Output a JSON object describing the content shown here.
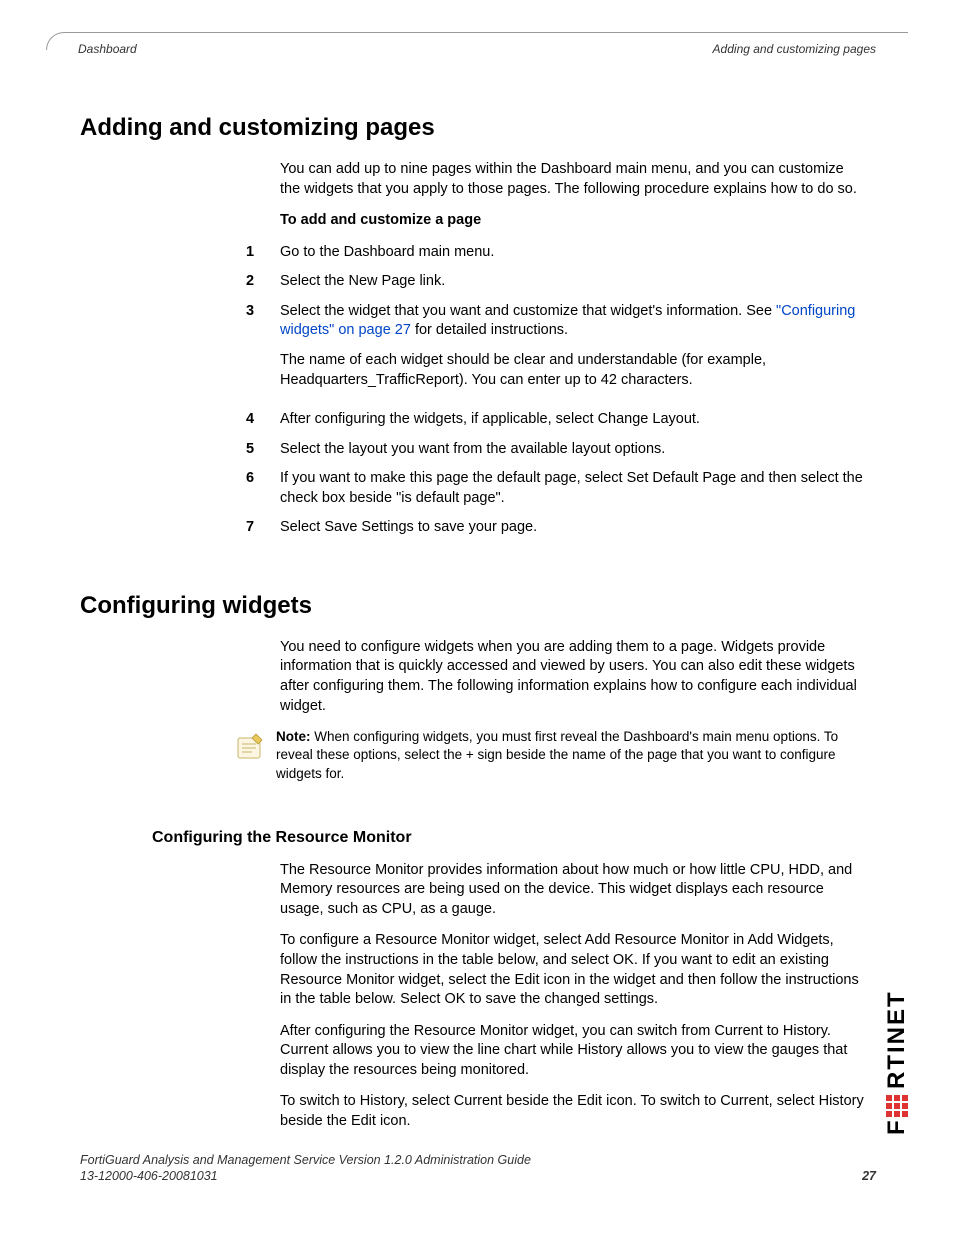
{
  "header": {
    "left": "Dashboard",
    "right": "Adding and customizing pages"
  },
  "section1": {
    "title": "Adding and customizing pages",
    "intro": "You can add up to nine pages within the Dashboard main menu, and you can customize the widgets that you apply to those pages. The following procedure explains how to do so.",
    "procTitle": "To add and customize a page",
    "steps": {
      "s1": "Go to the Dashboard main menu.",
      "s2": "Select the New Page link.",
      "s3a": "Select the widget that you want and customize that widget's information. See ",
      "s3link": "\"Configuring widgets\" on page 27",
      "s3b": " for detailed instructions.",
      "s3p2": "The name of each widget should be clear and understandable (for example, Headquarters_TrafficReport). You can enter up to 42 characters.",
      "s4": "After configuring the widgets, if applicable, select Change Layout.",
      "s5": "Select the layout you want from the available layout options.",
      "s6": "If you want to make this page the default page, select Set Default Page and then select the check box beside \"is default page\".",
      "s7": "Select Save Settings to save your page."
    }
  },
  "section2": {
    "title": "Configuring widgets",
    "intro": "You need to configure widgets when you are adding them to a page. Widgets provide information that is quickly accessed and viewed by users. You can also edit these widgets after configuring them. The following information explains how to configure each individual widget.",
    "noteLabel": "Note:",
    "noteText": " When configuring widgets, you must first reveal the Dashboard's main menu options. To reveal these options, select the + sign beside the name of the page that you want to configure widgets for.",
    "sub": {
      "title": "Configuring the Resource Monitor",
      "p1": "The Resource Monitor provides information about how much or how little CPU, HDD, and Memory resources are being used on the device. This widget displays each resource usage, such as CPU, as a gauge.",
      "p2": "To configure a Resource Monitor widget, select Add Resource Monitor in Add Widgets, follow the instructions in the table below, and select OK. If you want to edit an existing Resource Monitor widget, select the Edit icon in the widget and then follow the instructions in the table below. Select OK to save the changed settings.",
      "p3": "After configuring the Resource Monitor widget, you can switch from Current to History. Current allows you to view the line chart while History allows you to view the gauges that display the resources being monitored.",
      "p4": "To switch to History, select Current beside the Edit icon. To switch to Current, select History beside the Edit icon."
    }
  },
  "footer": {
    "line1": "FortiGuard Analysis and Management Service Version 1.2.0 Administration Guide",
    "line2": "13-12000-406-20081031",
    "page": "27"
  }
}
